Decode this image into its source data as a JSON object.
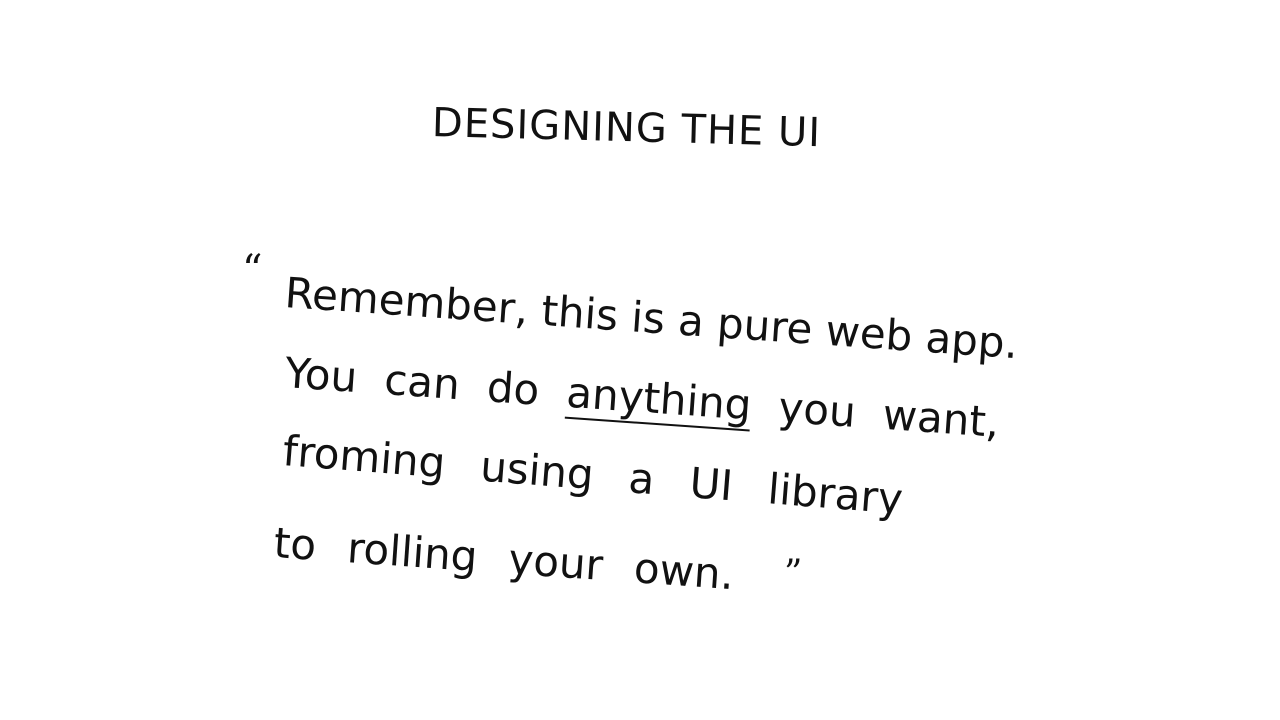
{
  "slide": {
    "title": "DESIGNING THE UI",
    "quote_open": "“",
    "quote_close": "”",
    "lines": [
      {
        "text": "Remember, this is a pure web app."
      },
      {
        "before": "You can do ",
        "emphasis": "anything",
        "after": " you want,"
      },
      {
        "text": "froming using a UI library"
      },
      {
        "text": "to rolling your own."
      }
    ]
  }
}
